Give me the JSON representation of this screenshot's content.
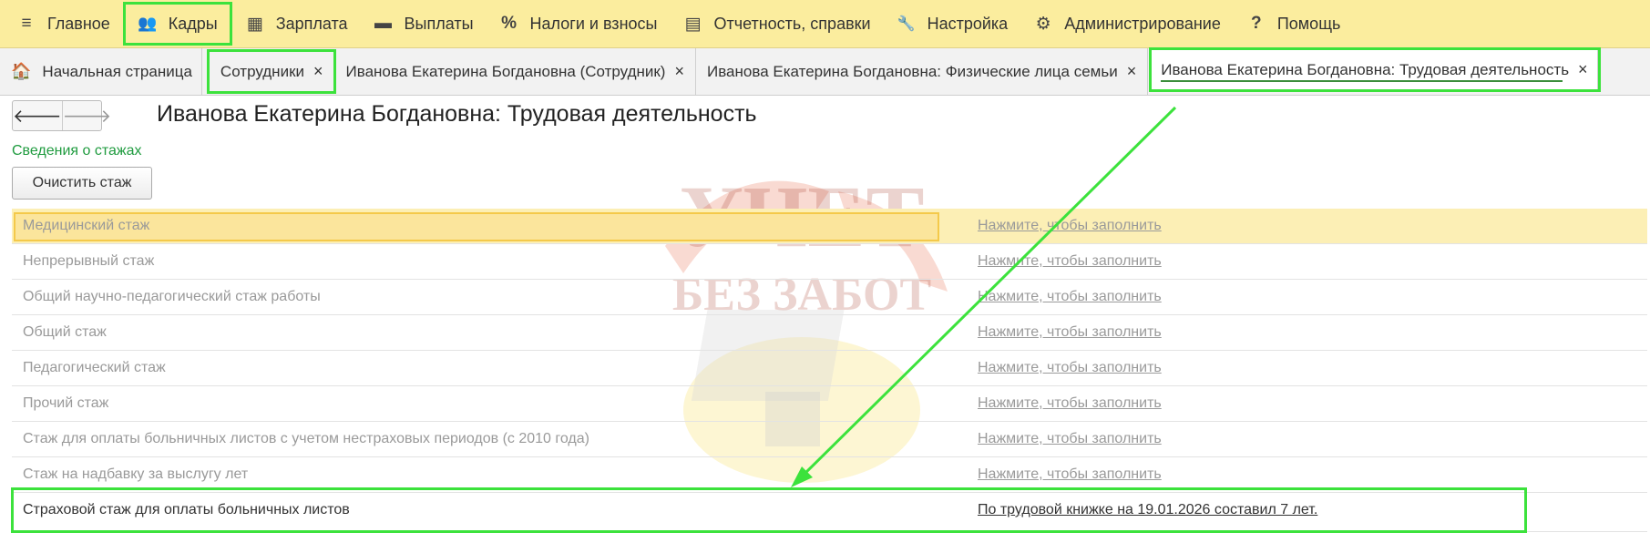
{
  "menu": [
    {
      "icon": "≡",
      "icon_name": "hamburger-icon",
      "label": "Главное"
    },
    {
      "icon": "👥",
      "icon_name": "users-icon",
      "label": "Кадры"
    },
    {
      "icon": "▦",
      "icon_name": "calculator-icon",
      "label": "Зарплата"
    },
    {
      "icon": "▬",
      "icon_name": "payment-icon",
      "label": "Выплаты"
    },
    {
      "icon": "%",
      "icon_name": "percent-icon",
      "label": "Налоги и взносы"
    },
    {
      "icon": "▤",
      "icon_name": "reports-icon",
      "label": "Отчетность, справки"
    },
    {
      "icon": "🔧",
      "icon_name": "wrench-icon",
      "label": "Настройка"
    },
    {
      "icon": "⚙",
      "icon_name": "gear-icon",
      "label": "Администрирование"
    },
    {
      "icon": "?",
      "icon_name": "help-icon",
      "label": "Помощь"
    }
  ],
  "tabs": [
    {
      "label": "Начальная страница",
      "icon": "🏠"
    },
    {
      "label": "Сотрудники",
      "close": "×"
    },
    {
      "label": "Иванова Екатерина Богдановна (Сотрудник)",
      "close": "×"
    },
    {
      "label": "Иванова Екатерина Богдановна: Физические лица семьи",
      "close": "×"
    },
    {
      "label": "Иванова Екатерина Богдановна: Трудовая деятельность",
      "close": "×"
    }
  ],
  "nav": {
    "back": "🡐",
    "forward": "🡒"
  },
  "page_title": "Иванова Екатерина Богдановна: Трудовая деятельность",
  "section_title": "Сведения о стажах",
  "clear_button": "Очистить стаж",
  "rows": [
    {
      "name": "Медицинский стаж",
      "value": "Нажмите, чтобы заполнить"
    },
    {
      "name": "Непрерывный стаж",
      "value": "Нажмите, чтобы заполнить"
    },
    {
      "name": "Общий научно-педагогический стаж работы",
      "value": "Нажмите, чтобы заполнить"
    },
    {
      "name": "Общий стаж",
      "value": "Нажмите, чтобы заполнить"
    },
    {
      "name": "Педагогический стаж",
      "value": "Нажмите, чтобы заполнить"
    },
    {
      "name": "Прочий стаж",
      "value": "Нажмите, чтобы заполнить"
    },
    {
      "name": "Стаж для оплаты больничных листов с учетом нестраховых периодов (с 2010 года)",
      "value": "Нажмите, чтобы заполнить"
    },
    {
      "name": "Стаж на надбавку за выслугу лет",
      "value": "Нажмите, чтобы заполнить"
    },
    {
      "name": "Страховой стаж для оплаты больничных листов",
      "value": "По трудовой книжке на 19.01.2026 составил 7 лет."
    }
  ],
  "watermark": {
    "line1": "УЧЕТ",
    "line2": "БЕЗ ЗАБОТ"
  },
  "colors": {
    "menu_bg": "#fbed9e",
    "highlight": "#3ce23c",
    "section": "#1f9b3f",
    "selected_row": "#fcefb5"
  }
}
